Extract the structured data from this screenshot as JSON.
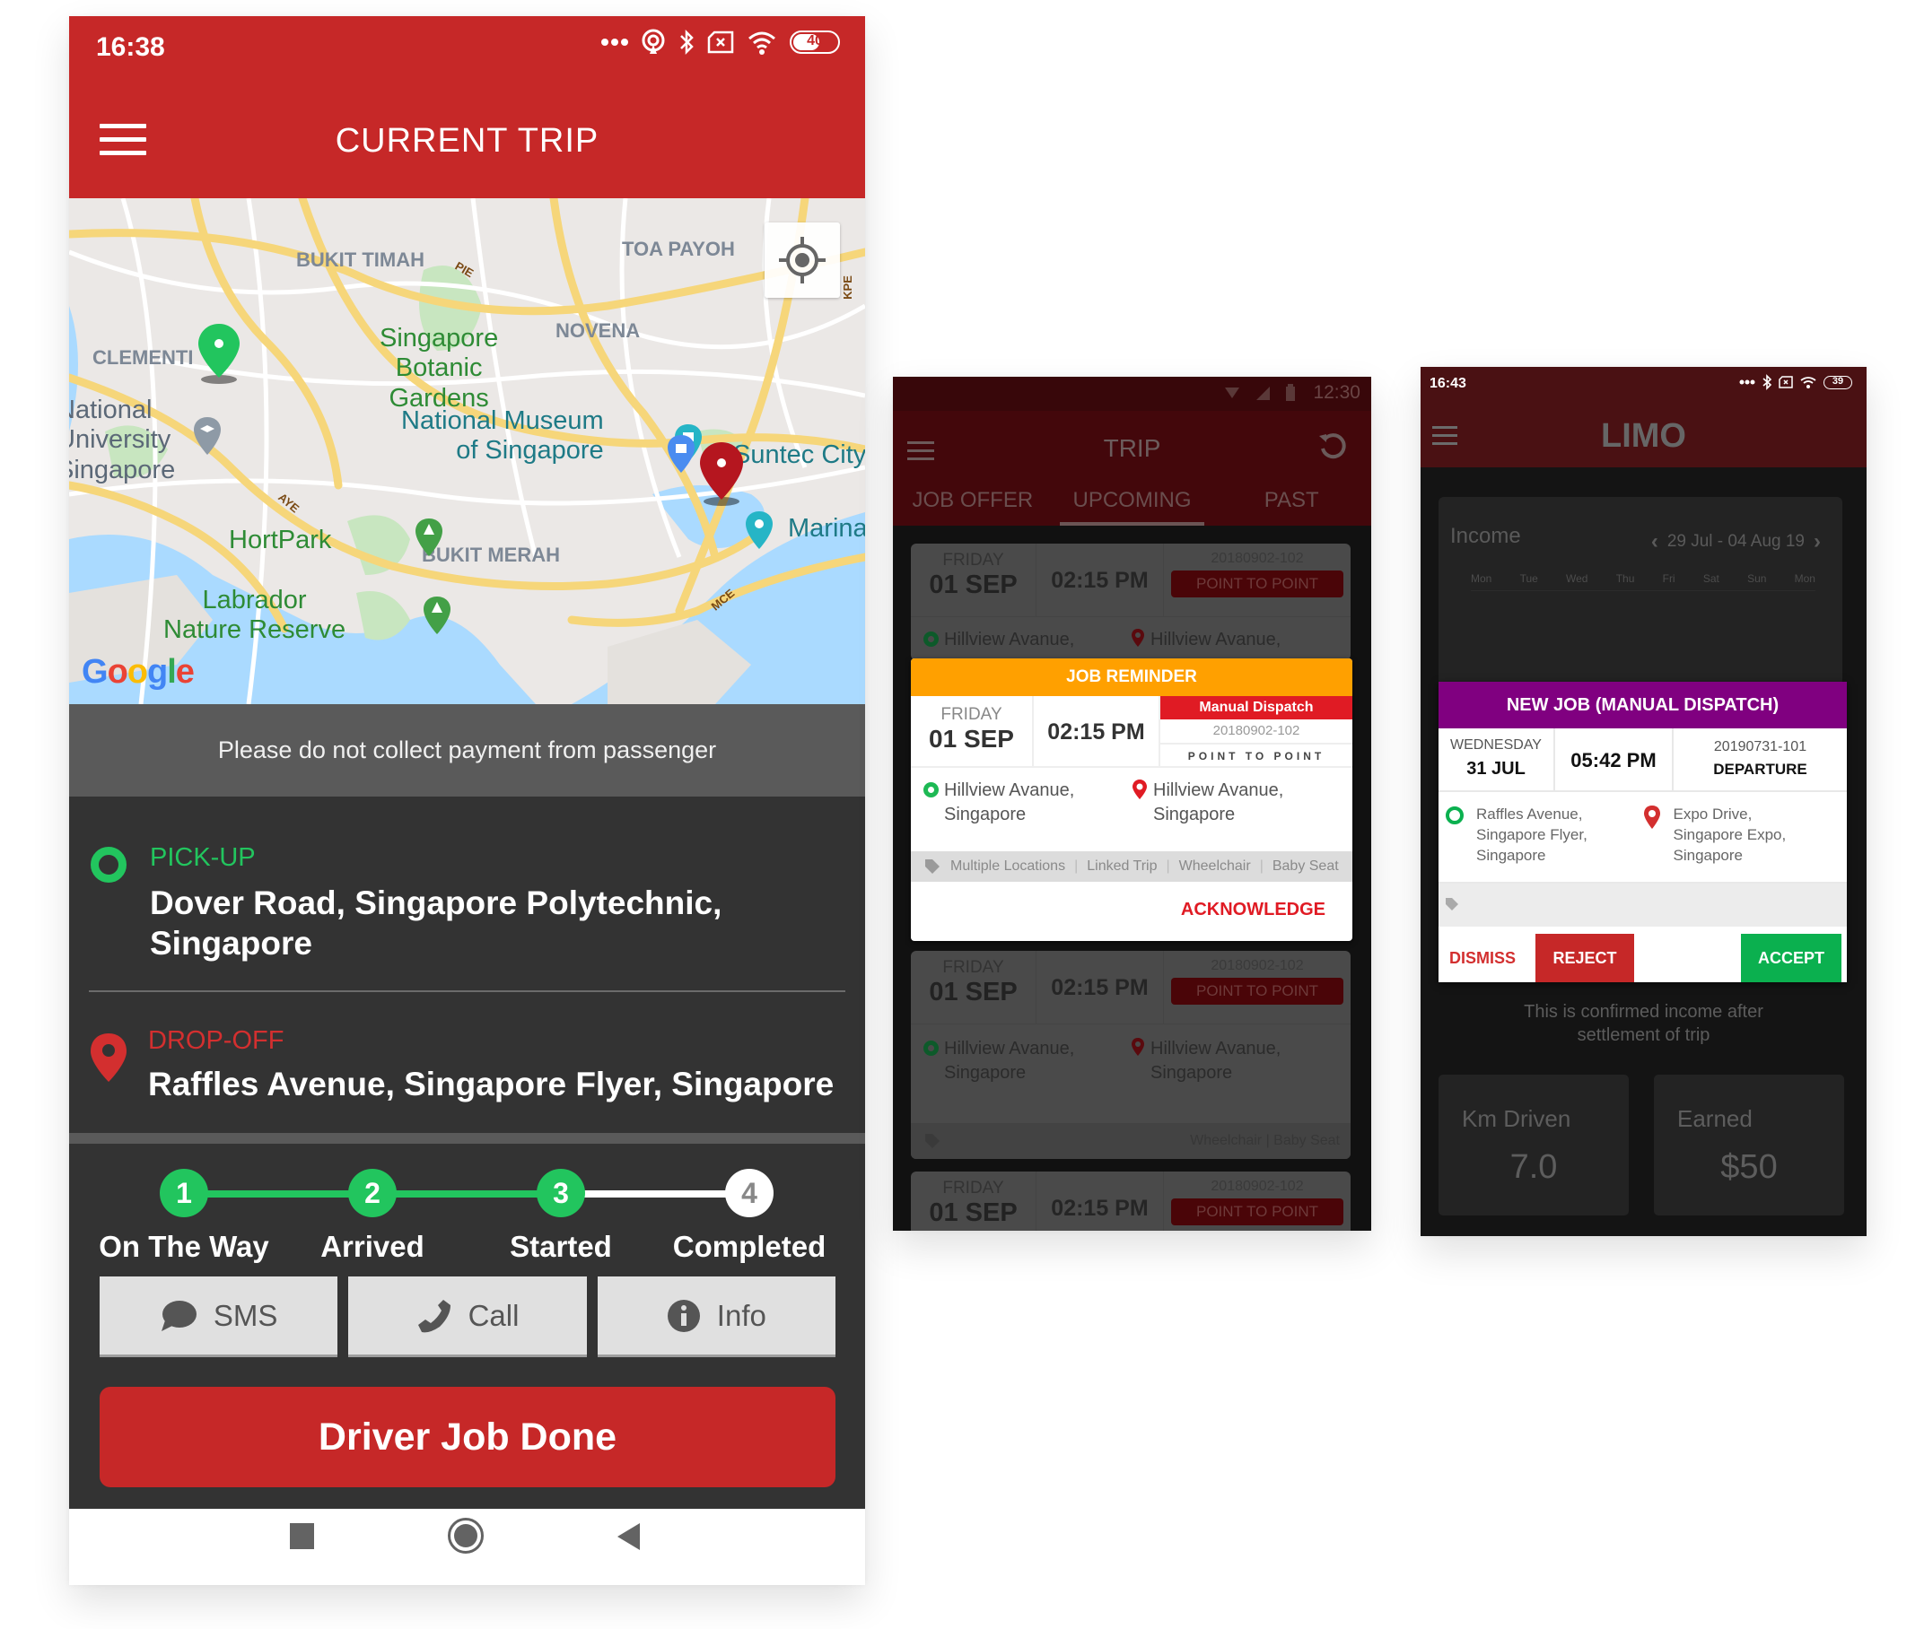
{
  "current_trip_screen": {
    "status_bar": {
      "time": "16:38",
      "battery": "40"
    },
    "title": "CURRENT TRIP",
    "map": {
      "district_labels": [
        "BUKIT TIMAH",
        "TOA PAYOH",
        "NOVENA",
        "CLEMENTI",
        "BUKIT MERAH"
      ],
      "places": {
        "botanic": "Singapore\nBotanic\nGardens",
        "museum": "National Museum\nof Singapore",
        "nus": "National\nUniversity\nSingapore",
        "suntec": "Suntec City",
        "marina": "Marina",
        "hortpark": "HortPark",
        "labrador": "Labrador\nNature Reserve"
      },
      "roads": [
        "PIE",
        "AYE",
        "MCE",
        "KPE"
      ],
      "attribution": "Google"
    },
    "notice": "Please do not collect payment from passenger",
    "pickup": {
      "label": "PICK-UP",
      "address": "Dover Road, Singapore Polytechnic, Singapore"
    },
    "dropoff": {
      "label": "DROP-OFF",
      "address": "Raffles Avenue, Singapore Flyer, Singapore"
    },
    "progress": {
      "current_step": 3,
      "steps": [
        {
          "num": "1",
          "label": "On The Way",
          "done": true
        },
        {
          "num": "2",
          "label": "Arrived",
          "done": true
        },
        {
          "num": "3",
          "label": "Started",
          "done": true
        },
        {
          "num": "4",
          "label": "Completed",
          "done": false
        }
      ]
    },
    "actions": [
      {
        "icon": "chat-bubble-icon",
        "label": "SMS"
      },
      {
        "icon": "phone-icon",
        "label": "Call"
      },
      {
        "icon": "info-icon",
        "label": "Info"
      }
    ],
    "primary_button": "Driver Job Done",
    "colors": {
      "brand_red": "#c62828",
      "green": "#22c55e",
      "dark_bg": "#333333"
    }
  },
  "trip_list_screen": {
    "status_bar": {
      "time": "12:30"
    },
    "title": "TRIP",
    "tabs": [
      {
        "label": "JOB OFFER",
        "active": false
      },
      {
        "label": "UPCOMING",
        "active": true
      },
      {
        "label": "PAST",
        "active": false
      }
    ],
    "cards": [
      {
        "dow": "FRIDAY",
        "date": "01 SEP",
        "time": "02:15 PM",
        "ref": "20180902-102",
        "type": "POINT TO POINT",
        "pickup": "Hillview Avanue,",
        "dropoff": "Hillview Avanue,"
      },
      {
        "dow": "FRIDAY",
        "date": "01 SEP",
        "time": "02:15 PM",
        "ref": "20180902-102",
        "type": "POINT TO POINT",
        "pickup": "Hillview Avanue,\nSingapore",
        "dropoff": "Hillview Avanue,\nSingapore",
        "tags": "Wheelchair | Baby Seat"
      },
      {
        "dow": "FRIDAY",
        "date": "01 SEP",
        "time": "02:15 PM",
        "ref": "20180902-102",
        "type": "POINT TO POINT"
      }
    ],
    "reminder": {
      "header": "JOB REMINDER",
      "dow": "FRIDAY",
      "date": "01 SEP",
      "time": "02:15 PM",
      "badge": "Manual Dispatch",
      "ref": "20180902-102",
      "type": "POINT TO POINT",
      "pickup": "Hillview Avanue,\nSingapore",
      "dropoff": "Hillview Avanue,\nSingapore",
      "tags": [
        "Multiple Locations",
        "Linked Trip",
        "Wheelchair",
        "Baby Seat"
      ],
      "action": "ACKNOWLEDGE"
    }
  },
  "limo_screen": {
    "status_bar": {
      "time": "16:43",
      "battery": "39"
    },
    "title": "LIMO",
    "income": {
      "label": "Income",
      "range": "29 Jul - 04 Aug 19",
      "days": [
        "Mon",
        "Tue",
        "Wed",
        "Thu",
        "Fri",
        "Sat",
        "Sun",
        "Mon"
      ]
    },
    "new_job": {
      "header": "NEW JOB (MANUAL DISPATCH)",
      "dow": "WEDNESDAY",
      "date": "31 JUL",
      "time": "05:42 PM",
      "ref": "20190731-101",
      "type": "DEPARTURE",
      "pickup": "Raffles Avenue,\nSingapore Flyer,\nSingapore",
      "dropoff": "Expo Drive,\nSingapore Expo,\nSingapore",
      "dismiss": "DISMISS",
      "reject": "REJECT",
      "accept": "ACCEPT"
    },
    "confirm_note": "This is confirmed income after\nsettlement of trip",
    "stats": [
      {
        "label": "Km Driven",
        "value": "7.0"
      },
      {
        "label": "Earned",
        "value": "$50"
      }
    ],
    "colors": {
      "header_purple": "#800080",
      "accept_green": "#0bb04f",
      "reject_red": "#c62828"
    }
  }
}
